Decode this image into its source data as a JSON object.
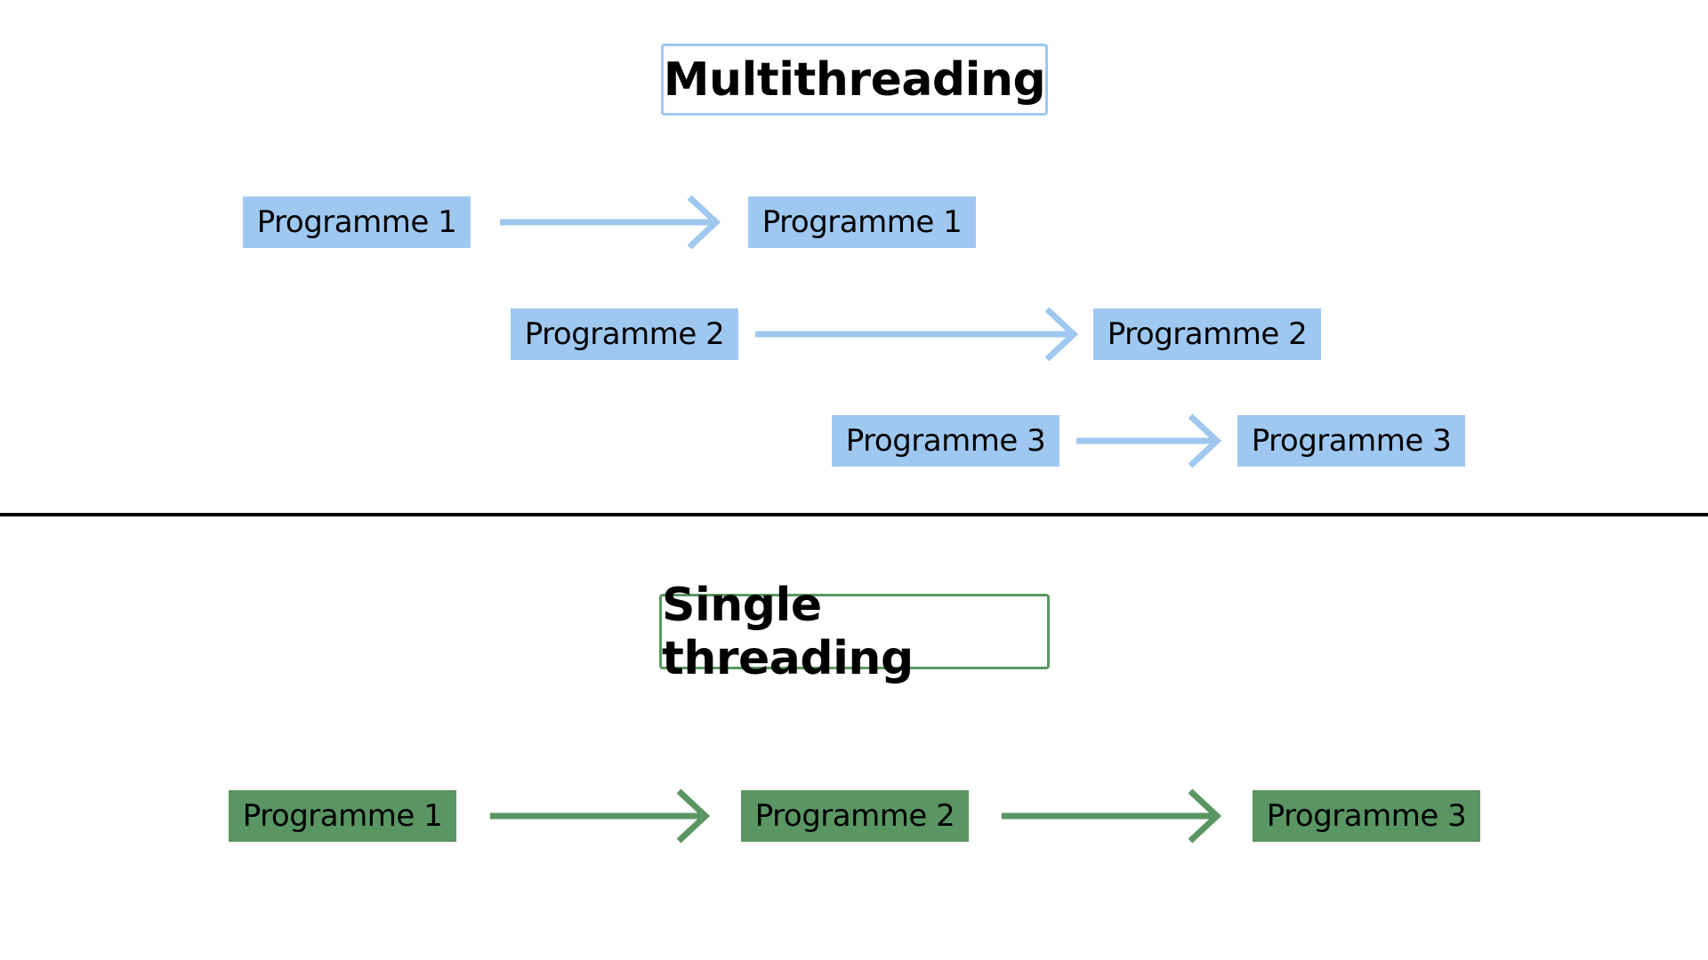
{
  "multithreading": {
    "title": "Multithreading",
    "color": "#9fc8f0",
    "rows": [
      {
        "from": "Programme 1",
        "to": "Programme 1"
      },
      {
        "from": "Programme 2",
        "to": "Programme 2"
      },
      {
        "from": "Programme 3",
        "to": "Programme 3"
      }
    ]
  },
  "single_threading": {
    "title": "Single threading",
    "color": "#5a9664",
    "sequence": [
      "Programme 1",
      "Programme 2",
      "Programme 3"
    ]
  }
}
